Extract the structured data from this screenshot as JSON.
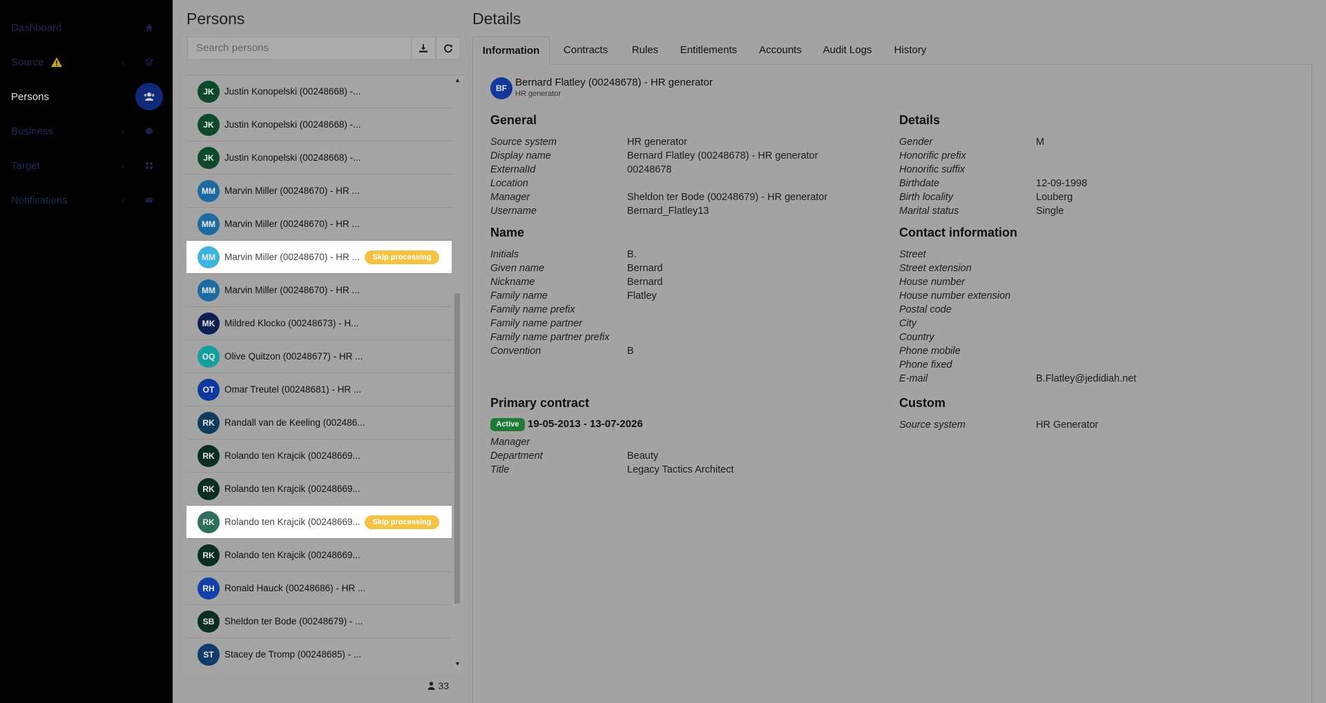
{
  "sidebar": {
    "items": [
      {
        "label": "Dashboard",
        "icon": "home-icon"
      },
      {
        "label": "Source",
        "icon": "database-icon",
        "warning": true
      },
      {
        "label": "Persons",
        "icon": "users-icon",
        "active": true
      },
      {
        "label": "Business",
        "icon": "sitemap-icon"
      },
      {
        "label": "Target",
        "icon": "grid-icon"
      },
      {
        "label": "Notifications",
        "icon": "envelope-icon"
      }
    ]
  },
  "persons_panel": {
    "title": "Persons",
    "search_placeholder": "Search persons",
    "count": "33",
    "items": [
      {
        "initials": "JK",
        "name": "Justin Konopelski (00248668) -...",
        "color": "#0d4a2a",
        "skip": false
      },
      {
        "initials": "JK",
        "name": "Justin Konopelski (00248668) -...",
        "color": "#0d4a2a",
        "skip": false
      },
      {
        "initials": "JK",
        "name": "Justin Konopelski (00248668) -...",
        "color": "#0d4a2a",
        "skip": false
      },
      {
        "initials": "MM",
        "name": "Marvin Miller (00248670) - HR ...",
        "color": "#1d6aa0",
        "skip": false
      },
      {
        "initials": "MM",
        "name": "Marvin Miller (00248670) - HR ...",
        "color": "#1d6aa0",
        "skip": false
      },
      {
        "initials": "MM",
        "name": "Marvin Miller (00248670) - HR ...",
        "color": "#3cb4dc",
        "skip": true
      },
      {
        "initials": "MM",
        "name": "Marvin Miller (00248670) - HR ...",
        "color": "#1d6aa0",
        "skip": false
      },
      {
        "initials": "MK",
        "name": "Mildred Klocko (00248673) - H...",
        "color": "#0e1f56",
        "skip": false
      },
      {
        "initials": "OQ",
        "name": "Olive Quitzon (00248677) - HR ...",
        "color": "#15a0a0",
        "skip": false
      },
      {
        "initials": "OT",
        "name": "Omar Treutel (00248681) - HR ...",
        "color": "#0e3aa0",
        "skip": false
      },
      {
        "initials": "RK",
        "name": "Randall van de Keeling (002486...",
        "color": "#0f3c5c",
        "skip": false
      },
      {
        "initials": "RK",
        "name": "Rolando ten Krajcik (00248669...",
        "color": "#0b2e22",
        "skip": false
      },
      {
        "initials": "RK",
        "name": "Rolando ten Krajcik (00248669...",
        "color": "#0b2e22",
        "skip": false
      },
      {
        "initials": "RK",
        "name": "Rolando ten Krajcik (00248669...",
        "color": "#2f6e5e",
        "skip": true
      },
      {
        "initials": "RK",
        "name": "Rolando ten Krajcik (00248669...",
        "color": "#0b2e22",
        "skip": false
      },
      {
        "initials": "RH",
        "name": "Ronald Hauck (00248686) - HR ...",
        "color": "#1240a8",
        "skip": false
      },
      {
        "initials": "SB",
        "name": "Sheldon ter Bode (00248679) - ...",
        "color": "#0b2e22",
        "skip": false
      },
      {
        "initials": "ST",
        "name": "Stacey de Tromp (00248685) - ...",
        "color": "#0f3c6a",
        "skip": false
      }
    ],
    "skip_label": "Skip processing"
  },
  "details_panel": {
    "title": "Details",
    "tabs": [
      "Information",
      "Contracts",
      "Rules",
      "Entitlements",
      "Accounts",
      "Audit Logs",
      "History"
    ],
    "header": {
      "initials": "BF",
      "name": "Bernard Flatley (00248678) - HR generator",
      "subtitle": "HR generator"
    },
    "general": {
      "title": "General",
      "rows": [
        {
          "label": "Source system",
          "value": "HR generator"
        },
        {
          "label": "Display name",
          "value": "Bernard Flatley (00248678) - HR generator"
        },
        {
          "label": "ExternalId",
          "value": "00248678"
        },
        {
          "label": "Location",
          "value": ""
        },
        {
          "label": "Manager",
          "value": "Sheldon ter Bode (00248679) - HR generator"
        },
        {
          "label": "Username",
          "value": "Bernard_Flatley13"
        }
      ]
    },
    "name": {
      "title": "Name",
      "rows": [
        {
          "label": "Initials",
          "value": "B."
        },
        {
          "label": "Given name",
          "value": "Bernard"
        },
        {
          "label": "Nickname",
          "value": "Bernard"
        },
        {
          "label": "Family name",
          "value": "Flatley"
        },
        {
          "label": "Family name prefix",
          "value": ""
        },
        {
          "label": "Family name partner",
          "value": ""
        },
        {
          "label": "Family name partner prefix",
          "value": ""
        },
        {
          "label": "Convention",
          "value": "B"
        }
      ]
    },
    "primary_contract": {
      "title": "Primary contract",
      "status": "Active",
      "date_range": "19-05-2013 - 13-07-2026",
      "rows": [
        {
          "label": "Manager",
          "value": ""
        },
        {
          "label": "Department",
          "value": "Beauty"
        },
        {
          "label": "Title",
          "value": "Legacy Tactics Architect"
        }
      ]
    },
    "details": {
      "title": "Details",
      "rows": [
        {
          "label": "Gender",
          "value": "M"
        },
        {
          "label": "Honorific prefix",
          "value": ""
        },
        {
          "label": "Honorific suffix",
          "value": ""
        },
        {
          "label": "Birthdate",
          "value": "12-09-1998"
        },
        {
          "label": "Birth locality",
          "value": "Louberg"
        },
        {
          "label": "Marital status",
          "value": "Single"
        }
      ]
    },
    "contact": {
      "title": "Contact information",
      "rows": [
        {
          "label": "Street",
          "value": ""
        },
        {
          "label": "Street extension",
          "value": ""
        },
        {
          "label": "House number",
          "value": ""
        },
        {
          "label": "House number extension",
          "value": ""
        },
        {
          "label": "Postal code",
          "value": ""
        },
        {
          "label": "City",
          "value": ""
        },
        {
          "label": "Country",
          "value": ""
        },
        {
          "label": "Phone mobile",
          "value": ""
        },
        {
          "label": "Phone fixed",
          "value": ""
        },
        {
          "label": "E-mail",
          "value": "B.Flatley@jedidiah.net"
        }
      ]
    },
    "custom": {
      "title": "Custom",
      "rows": [
        {
          "label": "Source system",
          "value": "HR Generator"
        }
      ]
    }
  }
}
